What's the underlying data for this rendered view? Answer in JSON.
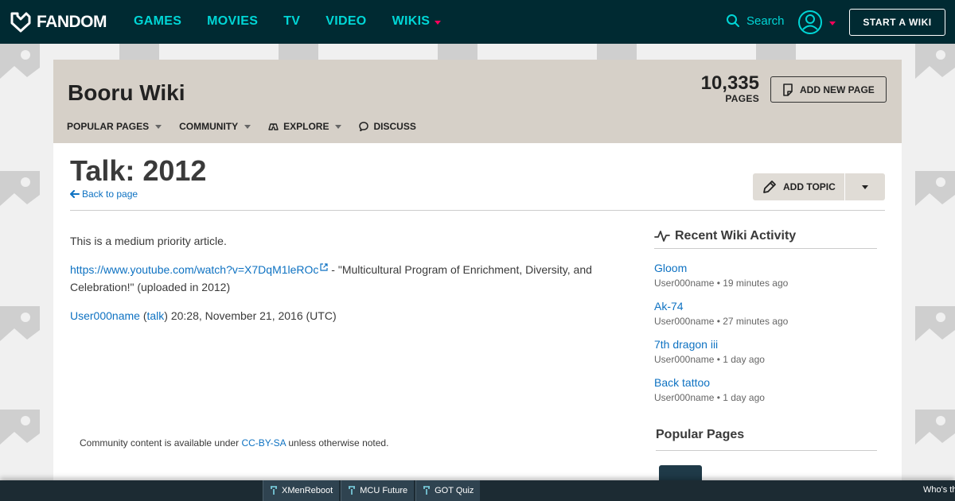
{
  "topnav": {
    "logo": "FANDOM",
    "links": [
      {
        "label": "GAMES"
      },
      {
        "label": "MOVIES"
      },
      {
        "label": "TV"
      },
      {
        "label": "VIDEO"
      },
      {
        "label": "WIKIS"
      }
    ],
    "search_label": "Search",
    "start_wiki": "START A WIKI"
  },
  "wiki": {
    "title": "Booru Wiki",
    "pages_count": "10,335",
    "pages_label": "PAGES",
    "add_new_page": "ADD NEW PAGE",
    "nav": [
      "POPULAR PAGES",
      "COMMUNITY",
      "EXPLORE",
      "DISCUSS"
    ]
  },
  "page": {
    "title": "Talk: 2012",
    "back_link": "Back to page",
    "add_topic": "ADD TOPIC",
    "priority": "This is a medium priority article.",
    "link_url": "https://www.youtube.com/watch?v=X7DqM1leROc",
    "link_desc": " - \"Multicultural Program of Enrichment, Diversity, and Celebration!\" (uploaded in 2012)",
    "sig_user": "User000name",
    "sig_open": " (",
    "sig_talk": "talk",
    "sig_close": ") 20:28, November 21, 2016 (UTC)",
    "license_pre": "Community content is available under ",
    "license_link": "CC-BY-SA",
    "license_post": " unless otherwise noted."
  },
  "rail": {
    "activity_title": "Recent Wiki Activity",
    "items": [
      {
        "title": "Gloom",
        "meta": "User000name • 19 minutes ago"
      },
      {
        "title": "Ak-74",
        "meta": "User000name • 27 minutes ago"
      },
      {
        "title": "7th dragon iii",
        "meta": "User000name • 1 day ago"
      },
      {
        "title": "Back tattoo",
        "meta": "User000name • 1 day ago"
      }
    ],
    "popular_title": "Popular Pages"
  },
  "bottombar": {
    "tabs": [
      "XMenReboot",
      "MCU Future",
      "GOT Quiz"
    ],
    "right_text": "Who's th"
  },
  "colors": {
    "nav_bg": "#002a32",
    "nav_link": "#00d6d6",
    "accent_red": "#fa005a",
    "wiki_header_bg": "#d6d0c8",
    "link": "#0e72c2"
  }
}
